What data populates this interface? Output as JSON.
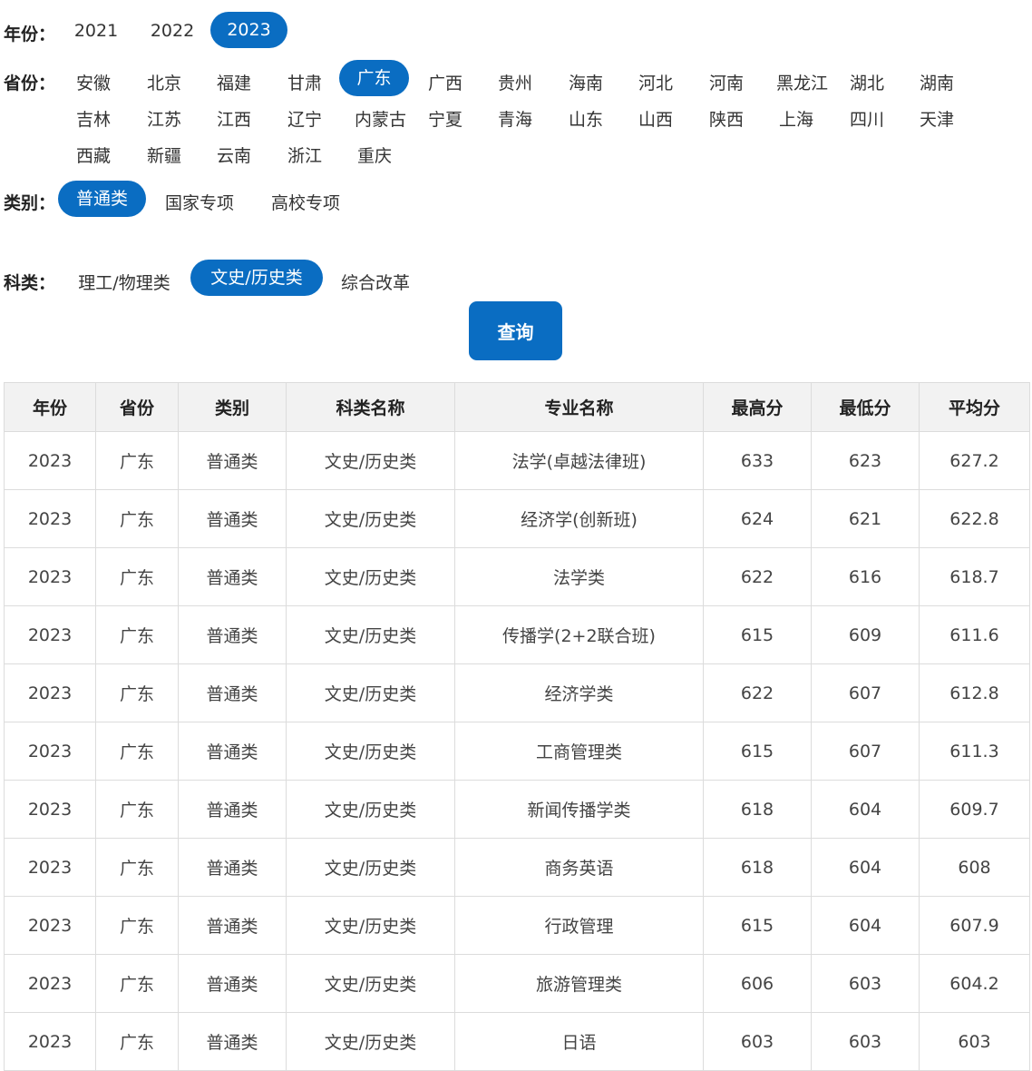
{
  "filters": {
    "year": {
      "label": "年份：",
      "options": [
        "2021",
        "2022",
        "2023"
      ],
      "selected": "2023"
    },
    "province": {
      "label": "省份：",
      "options": [
        "安徽",
        "北京",
        "福建",
        "甘肃",
        "广东",
        "广西",
        "贵州",
        "海南",
        "河北",
        "河南",
        "黑龙江",
        "湖北",
        "湖南",
        "吉林",
        "江苏",
        "江西",
        "辽宁",
        "内蒙古",
        "宁夏",
        "青海",
        "山东",
        "山西",
        "陕西",
        "上海",
        "四川",
        "天津",
        "西藏",
        "新疆",
        "云南",
        "浙江",
        "重庆"
      ],
      "selected": "广东"
    },
    "category": {
      "label": "类别：",
      "options": [
        "普通类",
        "国家专项",
        "高校专项"
      ],
      "selected": "普通类"
    },
    "subject": {
      "label": "科类：",
      "options": [
        "理工/物理类",
        "文史/历史类",
        "综合改革"
      ],
      "selected": "文史/历史类"
    },
    "query_label": "查询"
  },
  "table": {
    "headers": [
      "年份",
      "省份",
      "类别",
      "科类名称",
      "专业名称",
      "最高分",
      "最低分",
      "平均分"
    ],
    "rows": [
      [
        "2023",
        "广东",
        "普通类",
        "文史/历史类",
        "法学(卓越法律班)",
        "633",
        "623",
        "627.2"
      ],
      [
        "2023",
        "广东",
        "普通类",
        "文史/历史类",
        "经济学(创新班)",
        "624",
        "621",
        "622.8"
      ],
      [
        "2023",
        "广东",
        "普通类",
        "文史/历史类",
        "法学类",
        "622",
        "616",
        "618.7"
      ],
      [
        "2023",
        "广东",
        "普通类",
        "文史/历史类",
        "传播学(2+2联合班)",
        "615",
        "609",
        "611.6"
      ],
      [
        "2023",
        "广东",
        "普通类",
        "文史/历史类",
        "经济学类",
        "622",
        "607",
        "612.8"
      ],
      [
        "2023",
        "广东",
        "普通类",
        "文史/历史类",
        "工商管理类",
        "615",
        "607",
        "611.3"
      ],
      [
        "2023",
        "广东",
        "普通类",
        "文史/历史类",
        "新闻传播学类",
        "618",
        "604",
        "609.7"
      ],
      [
        "2023",
        "广东",
        "普通类",
        "文史/历史类",
        "商务英语",
        "618",
        "604",
        "608"
      ],
      [
        "2023",
        "广东",
        "普通类",
        "文史/历史类",
        "行政管理",
        "615",
        "604",
        "607.9"
      ],
      [
        "2023",
        "广东",
        "普通类",
        "文史/历史类",
        "旅游管理类",
        "606",
        "603",
        "604.2"
      ],
      [
        "2023",
        "广东",
        "普通类",
        "文史/历史类",
        "日语",
        "603",
        "603",
        "603"
      ]
    ]
  },
  "colors": {
    "accent": "#0a6dc2"
  }
}
